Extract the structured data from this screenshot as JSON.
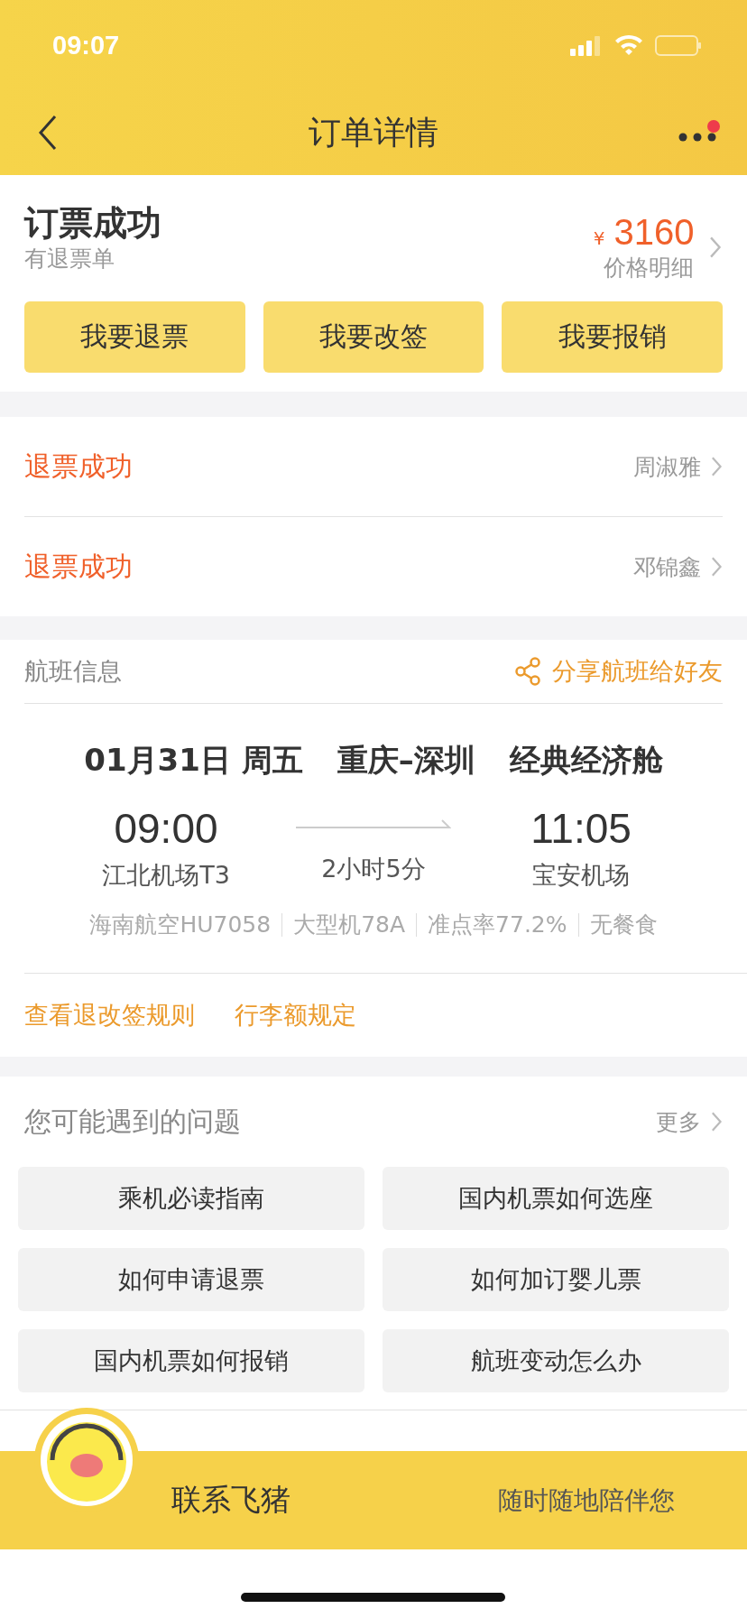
{
  "status_bar": {
    "time": "09:07"
  },
  "nav": {
    "title": "订单详情",
    "notification_dot": true
  },
  "order": {
    "status": "订票成功",
    "note": "有退票单",
    "currency": "¥",
    "price": "3160",
    "price_link": "价格明细"
  },
  "actions": [
    "我要退票",
    "我要改签",
    "我要报销"
  ],
  "refunds": [
    {
      "status": "退票成功",
      "passenger": "周淑雅"
    },
    {
      "status": "退票成功",
      "passenger": "邓锦鑫"
    }
  ],
  "flight": {
    "title": "航班信息",
    "share": "分享航班给好友",
    "date": "01月31日 周五",
    "route": "重庆–深圳",
    "cabin": "经典经济舱",
    "depart_time": "09:00",
    "depart_airport": "江北机场T3",
    "duration": "2小时5分",
    "arrive_time": "11:05",
    "arrive_airport": "宝安机场",
    "details": [
      "海南航空HU7058",
      "大型机78A",
      "准点率77.2%",
      "无餐食"
    ],
    "links": [
      "查看退改签规则",
      "行李额规定"
    ]
  },
  "questions": {
    "title": "您可能遇到的问题",
    "more": "更多",
    "items": [
      "乘机必读指南",
      "国内机票如何选座",
      "如何申请退票",
      "如何加订婴儿票",
      "国内机票如何报销",
      "航班变动怎么办"
    ]
  },
  "contact_bar": {
    "label": "联系飞猪",
    "slogan": "随时随地陪伴您"
  }
}
